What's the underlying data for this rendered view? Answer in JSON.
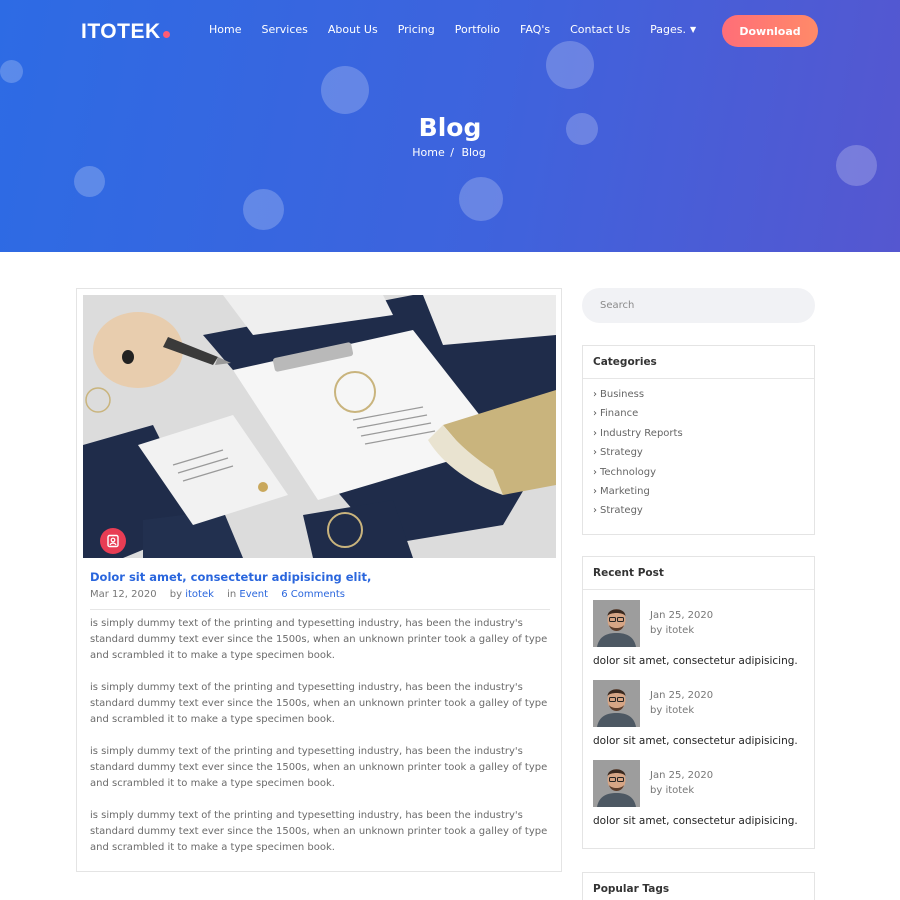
{
  "brand": {
    "name": "ITOTEK",
    "dot_color": "#ff5b73"
  },
  "nav": {
    "items": [
      {
        "label": "Home"
      },
      {
        "label": "Services"
      },
      {
        "label": "About Us"
      },
      {
        "label": "Pricing"
      },
      {
        "label": "Portfolio"
      },
      {
        "label": "FAQ's"
      },
      {
        "label": "Contact Us"
      },
      {
        "label": "Pages."
      }
    ],
    "download_label": "Download"
  },
  "hero": {
    "title": "Blog",
    "breadcrumb": {
      "home": "Home",
      "separator": "/",
      "current": "Blog"
    }
  },
  "post": {
    "image_icon": "image-gallery-icon",
    "title": "Dolor sit amet, consectetur adipisicing elit,",
    "date": "Mar 12, 2020",
    "by_label": "by",
    "author": "itotek",
    "in_label": "in",
    "category": "Event",
    "comments": "6 Comments",
    "paragraphs": [
      "is simply dummy text of the printing and typesetting industry, has been the industry's standard dummy text ever since the 1500s, when an unknown printer took a galley of type and scrambled it to make a type specimen book.",
      "is simply dummy text of the printing and typesetting industry, has been the industry's standard dummy text ever since the 1500s, when an unknown printer took a galley of type and scrambled it to make a type specimen book.",
      "is simply dummy text of the printing and typesetting industry, has been the industry's standard dummy text ever since the 1500s, when an unknown printer took a galley of type and scrambled it to make a type specimen book.",
      "is simply dummy text of the printing and typesetting industry, has been the industry's standard dummy text ever since the 1500s, when an unknown printer took a galley of type and scrambled it to make a type specimen book."
    ]
  },
  "sidebar": {
    "search_placeholder": "Search",
    "categories": {
      "title": "Categories",
      "items": [
        "Business",
        "Finance",
        "Industry Reports",
        "Strategy",
        "Technology",
        "Marketing",
        "Strategy"
      ]
    },
    "recent": {
      "title": "Recent Post",
      "items": [
        {
          "date": "Jan 25, 2020",
          "author": "by itotek",
          "title": "dolor sit amet, consectetur adipisicing."
        },
        {
          "date": "Jan 25, 2020",
          "author": "by itotek",
          "title": "dolor sit amet, consectetur adipisicing."
        },
        {
          "date": "Jan 25, 2020",
          "author": "by itotek",
          "title": "dolor sit amet, consectetur adipisicing."
        }
      ]
    },
    "tags": {
      "title": "Popular Tags"
    }
  },
  "colors": {
    "hero_start": "#2d6be4",
    "hero_end": "#5557d0",
    "accent_link": "#2a66dd",
    "download_button": "#ff7b70",
    "badge": "#e83d54"
  }
}
